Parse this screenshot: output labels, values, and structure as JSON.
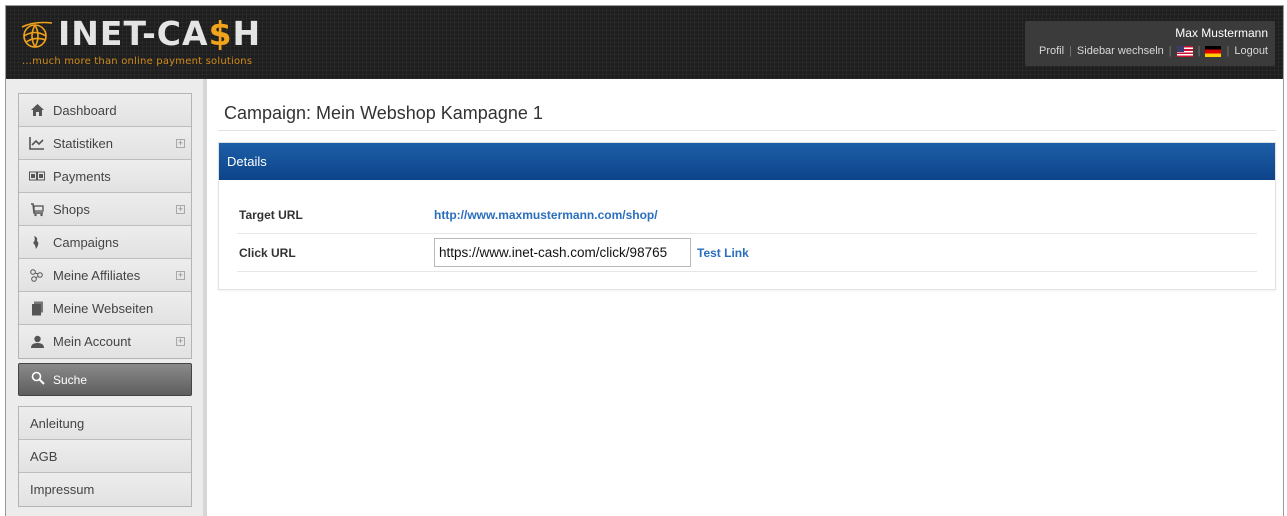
{
  "brand": {
    "logo_prefix": "INET-CA",
    "logo_dollar": "$",
    "logo_suffix": "H",
    "tagline": "...much more than online payment solutions",
    "accent_color": "#f2a31c"
  },
  "user": {
    "name": "Max Mustermann",
    "nav": {
      "profile": "Profil",
      "switch_sidebar": "Sidebar wechseln",
      "logout": "Logout"
    }
  },
  "sidebar": {
    "items": [
      {
        "label": "Dashboard",
        "icon": "home-icon",
        "expandable": false
      },
      {
        "label": "Statistiken",
        "icon": "chart-icon",
        "expandable": true
      },
      {
        "label": "Payments",
        "icon": "money-icon",
        "expandable": false
      },
      {
        "label": "Shops",
        "icon": "cart-icon",
        "expandable": true
      },
      {
        "label": "Campaigns",
        "icon": "campaign-icon",
        "expandable": false
      },
      {
        "label": "Meine Affiliates",
        "icon": "affiliates-icon",
        "expandable": true
      },
      {
        "label": "Meine Webseiten",
        "icon": "pages-icon",
        "expandable": false
      },
      {
        "label": "Mein Account",
        "icon": "user-icon",
        "expandable": true
      }
    ],
    "search_label": "Suche",
    "footer_items": [
      {
        "label": "Anleitung"
      },
      {
        "label": "AGB"
      },
      {
        "label": "Impressum"
      }
    ]
  },
  "main": {
    "title": "Campaign: Mein Webshop Kampagne 1",
    "panel_title": "Details",
    "header_color": "#0d4389",
    "target_url_label": "Target URL",
    "target_url": "http://www.maxmustermann.com/shop/",
    "click_url_label": "Click URL",
    "click_url_value": "https://www.inet-cash.com/click/98765",
    "test_link": "Test Link"
  }
}
